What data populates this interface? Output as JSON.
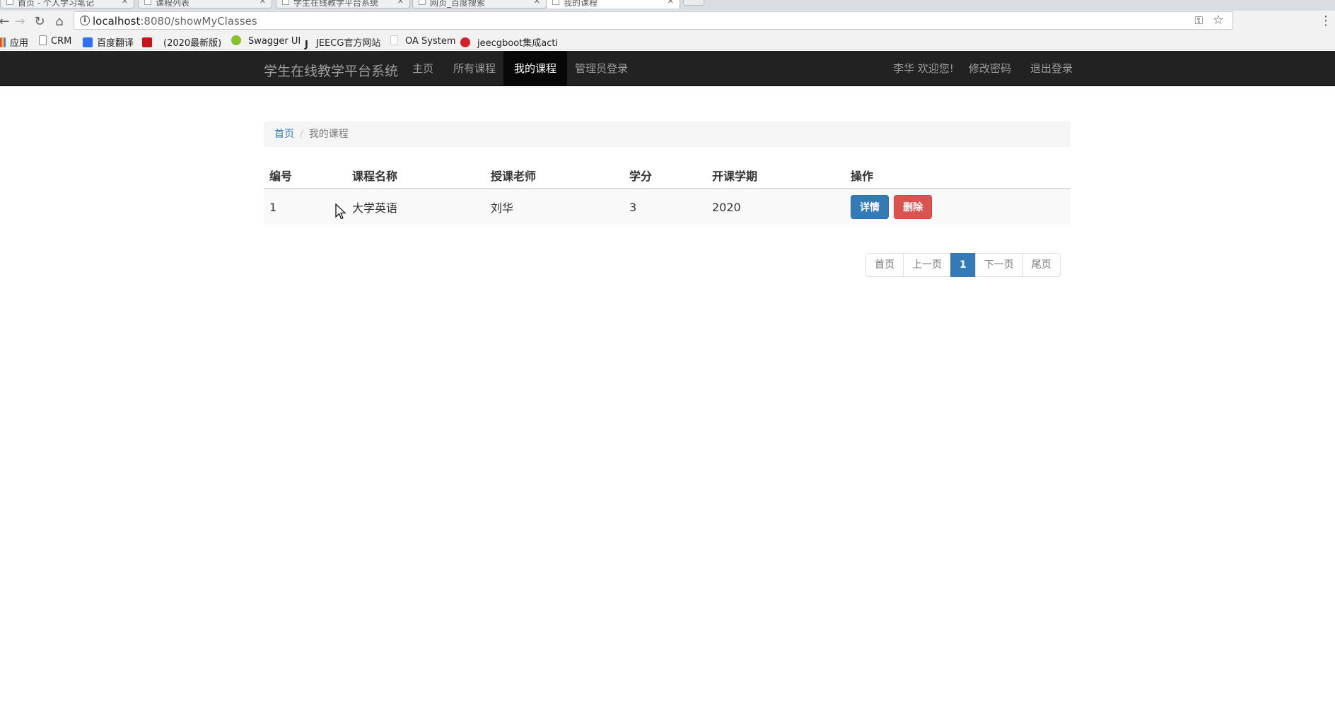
{
  "browser": {
    "tabs": [
      {
        "label": "首页 - 个人学习笔记"
      },
      {
        "label": "课程列表"
      },
      {
        "label": "学生在线教学平台系统"
      },
      {
        "label": "网页_百度搜索"
      },
      {
        "label": "我的课程"
      }
    ],
    "url_host": "localhost",
    "url_path": ":8080/showMyClasses",
    "bookmarks": [
      {
        "label": "应用",
        "color": "#e8453c"
      },
      {
        "label": "CRM",
        "color": "#ffffff"
      },
      {
        "label": "百度翻译",
        "color": "#2d6ff7"
      },
      {
        "label": "(2020最新版)",
        "color": "#c4161c"
      },
      {
        "label": "Swagger UI",
        "color": "#85c226"
      },
      {
        "label": "JEECG官方网站",
        "color": "#222222"
      },
      {
        "label": "OA System",
        "color": "#ffffff"
      },
      {
        "label": "jeecgboot集成activi",
        "color": "#d5202a"
      }
    ]
  },
  "navbar": {
    "brand": "学生在线教学平台系统",
    "items": [
      {
        "label": "主页"
      },
      {
        "label": "所有课程"
      },
      {
        "label": "我的课程",
        "active": true
      },
      {
        "label": "管理员登录"
      }
    ],
    "right": [
      {
        "label": "李华 欢迎您!"
      },
      {
        "label": "修改密码"
      },
      {
        "label": "退出登录"
      }
    ]
  },
  "breadcrumb": {
    "home": "首页",
    "current": "我的课程"
  },
  "table": {
    "headers": [
      "编号",
      "课程名称",
      "授课老师",
      "学分",
      "开课学期",
      "操作"
    ],
    "rows": [
      {
        "id": "1",
        "name": "大学英语",
        "teacher": "刘华",
        "credit": "3",
        "term": "2020",
        "detail_label": "详情",
        "delete_label": "删除"
      }
    ]
  },
  "pagination": {
    "first": "首页",
    "prev": "上一页",
    "current": "1",
    "next": "下一页",
    "last": "尾页"
  },
  "colors": {
    "navbar_bg": "#222222",
    "primary": "#337ab7",
    "danger": "#d9534f"
  }
}
